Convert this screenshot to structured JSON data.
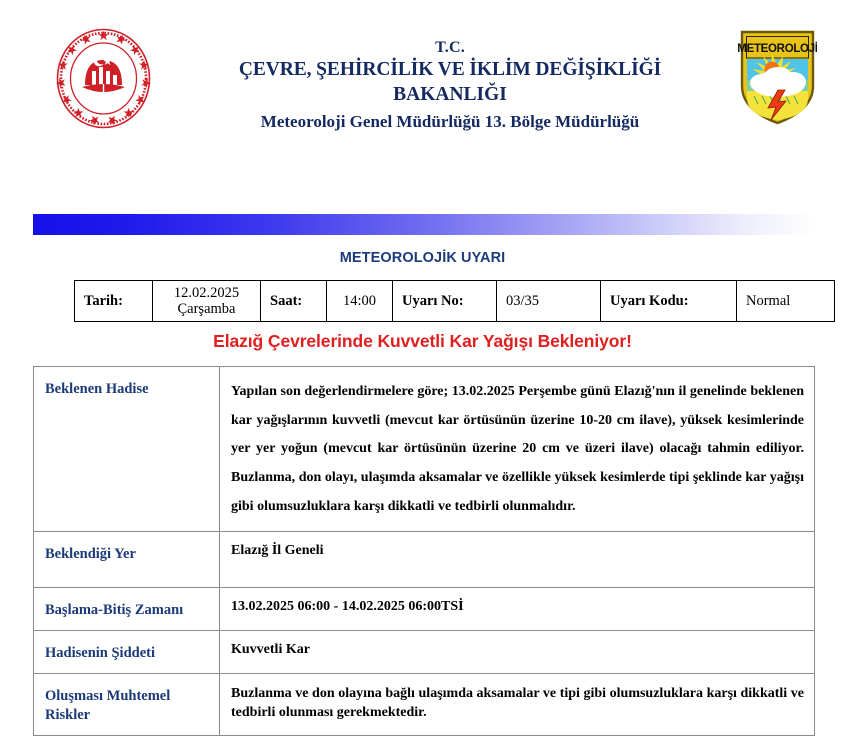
{
  "header": {
    "left_logo_name": "tc-cevre-sehircilik-iklim-degisikligi-bakanligi-seal",
    "left_logo_text": "T.C. ÇEVRE, ŞEHİRCİLİK VE İKLİM DEĞİŞİKLİĞİ BAKANLIĞI",
    "right_logo_name": "meteoroloji-shield-logo",
    "right_logo_text": "METEOROLOJİ",
    "line1": "T.C.",
    "line2": "ÇEVRE, ŞEHİRCİLİK VE İKLİM DEĞİŞİKLİĞİ",
    "line3": "BAKANLIĞI",
    "line4": "Meteoroloji Genel Müdürlüğü 13. Bölge Müdürlüğü"
  },
  "decoration": {
    "gradient_start_color": "#1510e8",
    "gradient_end_color": "#ffffff"
  },
  "document": {
    "heading": "METEOROLOJİK UYARI",
    "heading_color": "#1b3a78",
    "alert_headline": "Elazığ Çevrelerinde Kuvvetli Kar Yağışı Bekleniyor!",
    "alert_color": "#e02020"
  },
  "info_table": {
    "cells": [
      {
        "label": "Tarih:",
        "value": "12.02.2025\nÇarşamba"
      },
      {
        "label": "Saat:",
        "value": "14:00"
      },
      {
        "label": "Uyarı No:",
        "value": "03/35"
      },
      {
        "label": "Uyarı Kodu:",
        "value": "Normal"
      }
    ],
    "tarih_label": "Tarih:",
    "tarih_value_line1": "12.02.2025",
    "tarih_value_line2": "Çarşamba",
    "saat_label": "Saat:",
    "saat_value": "14:00",
    "uyari_no_label": "Uyarı No:",
    "uyari_no_value": "03/35",
    "uyari_kodu_label": "Uyarı Kodu:",
    "uyari_kodu_value": "Normal"
  },
  "detail_table": {
    "label_color": "#1b3a78",
    "rows": [
      {
        "label": "Beklenen Hadise",
        "value": "Yapılan son değerlendirmelere göre; 13.02.2025 Perşembe günü Elazığ'nın il genelinde beklenen kar yağışlarının kuvvetli (mevcut kar örtüsünün üzerine 10-20 cm ilave), yüksek kesimlerinde yer yer yoğun (mevcut kar örtüsünün üzerine 20 cm ve üzeri ilave) olacağı tahmin ediliyor. Buzlanma, don olayı, ulaşımda aksamalar ve özellikle yüksek kesimlerde tipi şeklinde kar yağışı gibi olumsuzluklara karşı dikkatli ve tedbirli olunmalıdır."
      },
      {
        "label": "Beklendiği Yer",
        "value": "Elazığ İl Geneli"
      },
      {
        "label": "Başlama-Bitiş Zamanı",
        "value": "13.02.2025 06:00 - 14.02.2025 06:00TSİ"
      },
      {
        "label": "Hadisenin Şiddeti",
        "value": "Kuvvetli Kar"
      },
      {
        "label": "Oluşması Muhtemel Riskler",
        "value": "Buzlanma ve don olayına bağlı ulaşımda aksamalar ve tipi gibi olumsuzluklara karşı dikkatli ve tedbirli olunması gerekmektedir."
      }
    ],
    "row0_label": "Beklenen Hadise",
    "row0_value": "Yapılan son değerlendirmelere göre; 13.02.2025 Perşembe günü Elazığ'nın il genelinde beklenen kar yağışlarının kuvvetli (mevcut kar örtüsünün üzerine 10-20 cm ilave), yüksek kesimlerinde yer yer yoğun (mevcut kar örtüsünün üzerine 20 cm ve üzeri ilave) olacağı tahmin ediliyor. Buzlanma, don olayı, ulaşımda aksamalar ve özellikle yüksek kesimlerde tipi şeklinde kar yağışı gibi olumsuzluklara karşı dikkatli ve tedbirli olunmalıdır.",
    "row1_label": "Beklendiği Yer",
    "row1_value": "Elazığ İl Geneli",
    "row2_label": "Başlama-Bitiş Zamanı",
    "row2_value": "13.02.2025 06:00 - 14.02.2025 06:00TSİ",
    "row3_label": "Hadisenin Şiddeti",
    "row3_value": "Kuvvetli Kar",
    "row4_label_line1": "Oluşması Muhtemel",
    "row4_label_line2": "Riskler",
    "row4_value": "Buzlanma ve don olayına bağlı ulaşımda aksamalar ve tipi gibi olumsuzluklara karşı dikkatli ve tedbirli olunması gerekmektedir."
  }
}
